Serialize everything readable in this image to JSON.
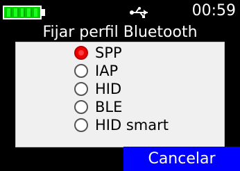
{
  "status": {
    "battery_level": 1.0,
    "usb_icon": "usb-icon",
    "time": "00:59"
  },
  "dialog": {
    "title": "Fijar perfil Bluetooth",
    "options": [
      {
        "label": "SPP",
        "selected": true
      },
      {
        "label": "IAP",
        "selected": false
      },
      {
        "label": "HID",
        "selected": false
      },
      {
        "label": "BLE",
        "selected": false
      },
      {
        "label": "HID smart",
        "selected": false
      }
    ],
    "cancel_label": "Cancelar"
  },
  "colors": {
    "background": "#000000",
    "panel": "#f0f0f0",
    "battery_fill": "#1bff1b",
    "selected_radio": "#e00000",
    "cancel_button": "#0000ff"
  }
}
